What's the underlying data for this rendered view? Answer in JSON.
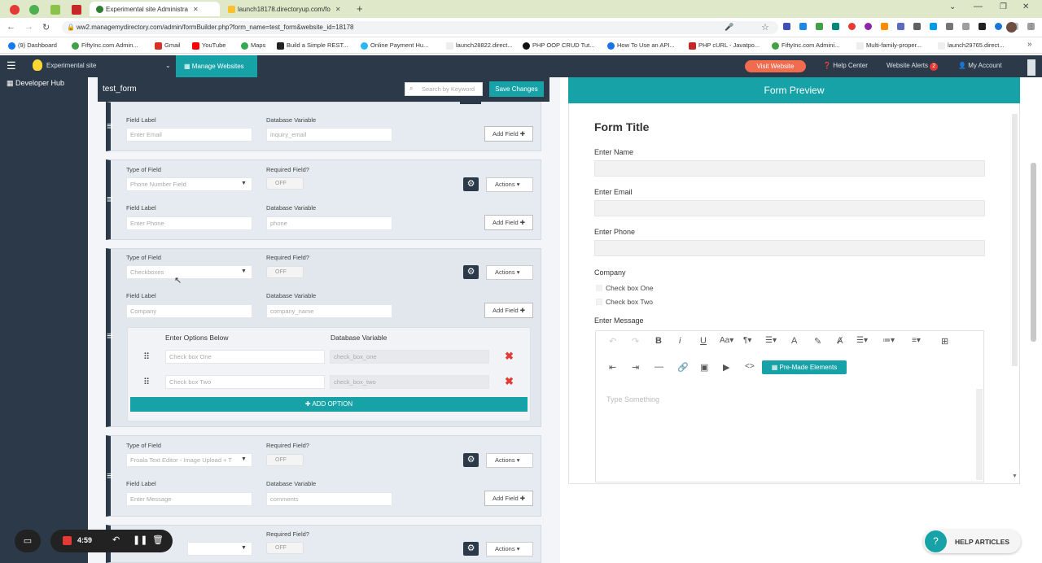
{
  "browser": {
    "tabs": [
      {
        "label": "Experimental site Administra"
      },
      {
        "label": "launch18178.directoryup.com/fo"
      }
    ],
    "url": "ww2.managemydirectory.com/admin/formBuilder.php?form_name=test_form&website_id=18178",
    "bookmarks": [
      "(9) Dashboard",
      "FiftyInc.com Admin...",
      "Gmail",
      "YouTube",
      "Maps",
      "Build a Simple REST...",
      "Online Payment Hu...",
      "launch28822.direct...",
      "PHP OOP CRUD Tut...",
      "How To Use an API...",
      "PHP cURL - Javatpo...",
      "FiftyInc.com Admini...",
      "Multi-family-proper...",
      "launch29765.direct..."
    ]
  },
  "appbar": {
    "site_name": "Experimental site",
    "manage_websites": "Manage Websites",
    "visit_website": "Visit Website",
    "help_center": "Help Center",
    "website_alerts": "Website Alerts",
    "alerts_count": "2",
    "my_account": "My Account"
  },
  "sidebar": {
    "developer_hub": "Developer Hub"
  },
  "builder": {
    "form_name": "test_form",
    "search_placeholder": "Search by Keyword",
    "save_changes": "Save Changes",
    "labels": {
      "type_of_field": "Type of Field",
      "required_field": "Required Field?",
      "field_label": "Field Label",
      "database_variable": "Database Variable",
      "add_field": "Add Field",
      "actions": "Actions",
      "off": "OFF",
      "enter_options_below": "Enter Options Below",
      "add_option": "ADD OPTION"
    },
    "fields": [
      {
        "field_label": "Enter Email",
        "db_var": "inquiry_email"
      },
      {
        "type": "Phone Number Field",
        "field_label": "Enter Phone",
        "db_var": "phone"
      },
      {
        "type": "Checkboxes",
        "field_label": "Company",
        "db_var": "company_name",
        "options": [
          {
            "label": "Check box One",
            "db_var": "check_box_one"
          },
          {
            "label": "Check box Two",
            "db_var": "check_box_two"
          }
        ]
      },
      {
        "type": "Froala Text Editor - Image Upload + T",
        "field_label": "Enter Message",
        "db_var": "comments"
      }
    ]
  },
  "preview": {
    "header": "Form Preview",
    "title": "Form Title",
    "name_label": "Enter Name",
    "email_label": "Enter Email",
    "phone_label": "Enter Phone",
    "company_label": "Company",
    "checkbox_one": "Check box One",
    "checkbox_two": "Check box Two",
    "message_label": "Enter Message",
    "premade": "Pre-Made Elements",
    "editor_placeholder": "Type Something"
  },
  "recorder": {
    "time": "4:59"
  },
  "help_articles": "HELP ARTICLES",
  "colors": {
    "dark": "#2b3948",
    "teal": "#17a2a8",
    "orange": "#f16b4e",
    "green": "#3ba36b",
    "red": "#e53935"
  }
}
